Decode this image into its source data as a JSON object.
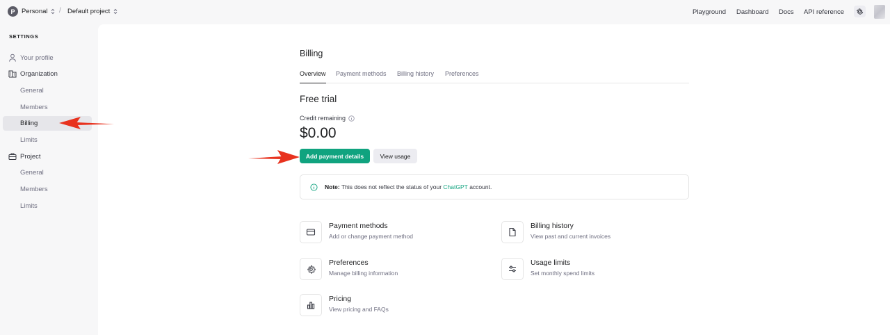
{
  "topbar": {
    "org_initial": "P",
    "org_name": "Personal",
    "separator": "/",
    "project_name": "Default project",
    "links": [
      "Playground",
      "Dashboard",
      "Docs",
      "API reference"
    ]
  },
  "sidebar": {
    "title": "SETTINGS",
    "your_profile": "Your profile",
    "organization": "Organization",
    "org_items": [
      "General",
      "Members",
      "Billing",
      "Limits"
    ],
    "project": "Project",
    "project_items": [
      "General",
      "Members",
      "Limits"
    ],
    "active_item": "Billing"
  },
  "billing": {
    "title": "Billing",
    "tabs": [
      "Overview",
      "Payment methods",
      "Billing history",
      "Preferences"
    ],
    "active_tab": "Overview",
    "plan": "Free trial",
    "credit_label": "Credit remaining",
    "credit_value": "$0.00",
    "primary_button": "Add payment details",
    "secondary_button": "View usage",
    "note_bold": "Note:",
    "note_text": " This does not reflect the status of your ",
    "note_link": "ChatGPT",
    "note_end": " account."
  },
  "cards": [
    {
      "title": "Payment methods",
      "desc": "Add or change payment method",
      "icon": "credit-card-icon"
    },
    {
      "title": "Billing history",
      "desc": "View past and current invoices",
      "icon": "document-icon"
    },
    {
      "title": "Preferences",
      "desc": "Manage billing information",
      "icon": "gear-icon"
    },
    {
      "title": "Usage limits",
      "desc": "Set monthly spend limits",
      "icon": "sliders-icon"
    },
    {
      "title": "Pricing",
      "desc": "View pricing and FAQs",
      "icon": "bar-chart-icon"
    }
  ],
  "colors": {
    "accent": "#10a37f",
    "annotation_arrow": "#e8321e",
    "sidebar_bg": "#f7f7f8"
  }
}
